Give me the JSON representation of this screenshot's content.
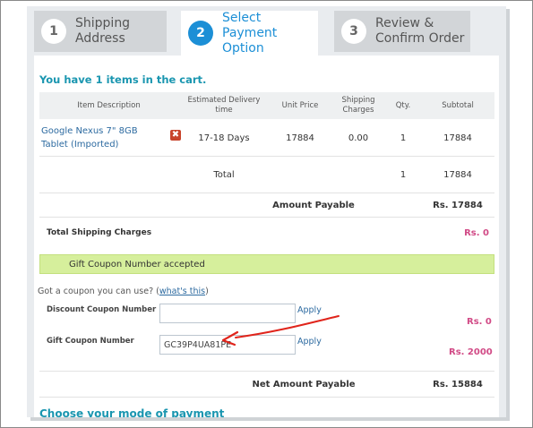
{
  "steps": [
    {
      "num": "1",
      "label": "Shipping\nAddress"
    },
    {
      "num": "2",
      "label": "Select\nPayment Option"
    },
    {
      "num": "3",
      "label": "Review &\nConfirm Order"
    }
  ],
  "cart": {
    "message": "You have 1 items in the cart.",
    "headers": {
      "item": "Item Description",
      "delivery": "Estimated Delivery time",
      "price": "Unit Price",
      "shipping": "Shipping Charges",
      "qty": "Qty.",
      "subtotal": "Subtotal"
    },
    "item": {
      "name": "Google Nexus 7\" 8GB Tablet (Imported)",
      "remove_symbol": "✖",
      "delivery": "17-18 Days",
      "price": "17884",
      "shipping": "0.00",
      "qty": "1",
      "subtotal": "17884"
    },
    "total": {
      "label": "Total",
      "qty": "1",
      "subtotal": "17884"
    },
    "amount_payable": {
      "label": "Amount Payable",
      "value": "Rs. 17884"
    },
    "total_shipping": {
      "label": "Total Shipping Charges",
      "value": "Rs. 0"
    }
  },
  "notice": "Gift Coupon Number accepted",
  "coupon": {
    "question": "Got a coupon you can use? (",
    "link": "what's this",
    "question_end": ")",
    "discount_label": "Discount Coupon Number",
    "discount_value": "",
    "discount_apply": "Apply",
    "discount_amount": "Rs. 0",
    "gift_label": "Gift Coupon Number",
    "gift_value": "GC39P4UA81PE",
    "gift_apply": "Apply",
    "gift_amount": "Rs. 2000"
  },
  "net": {
    "label": "Net Amount Payable",
    "value": "Rs. 15884"
  },
  "payment_heading": "Choose your mode of payment",
  "colors": {
    "accent": "#1c8fd6",
    "teal": "#1a96b0",
    "pink": "#d14a86",
    "notice_bg": "#d6ef9c",
    "annotation": "#e0241b"
  }
}
